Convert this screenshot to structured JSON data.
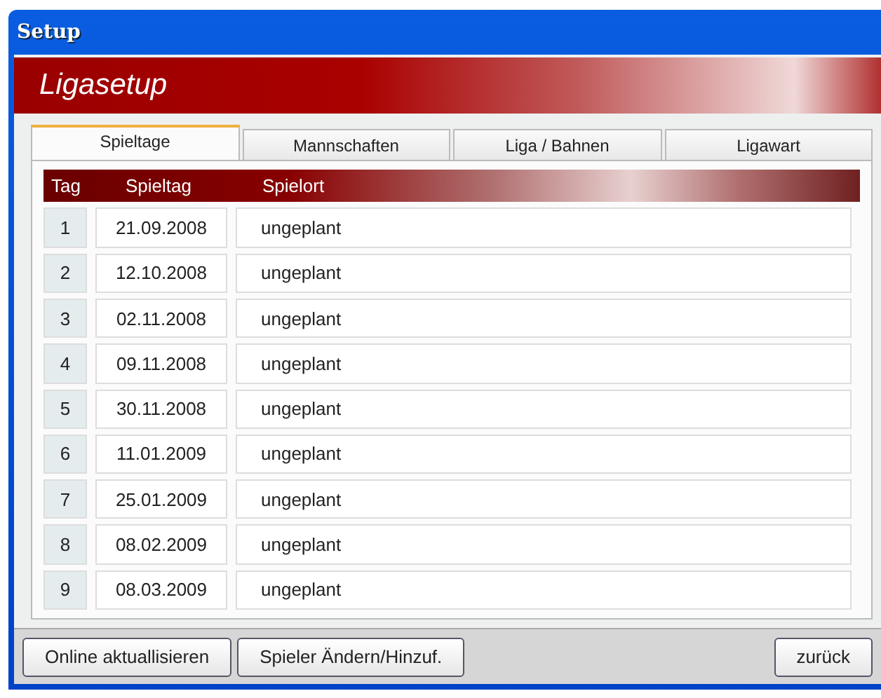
{
  "window": {
    "title": "Setup"
  },
  "header": {
    "title": "Ligasetup"
  },
  "tabs": [
    {
      "label": "Spieltage",
      "selected": true
    },
    {
      "label": "Mannschaften",
      "selected": false
    },
    {
      "label": "Liga / Bahnen",
      "selected": false
    },
    {
      "label": "Ligawart",
      "selected": false
    }
  ],
  "table": {
    "columns": [
      "Tag",
      "Spieltag",
      "Spielort"
    ],
    "rows": [
      [
        "1",
        "21.09.2008",
        "ungeplant"
      ],
      [
        "2",
        "12.10.2008",
        "ungeplant"
      ],
      [
        "3",
        "02.11.2008",
        "ungeplant"
      ],
      [
        "4",
        "09.11.2008",
        "ungeplant"
      ],
      [
        "5",
        "30.11.2008",
        "ungeplant"
      ],
      [
        "6",
        "11.01.2009",
        "ungeplant"
      ],
      [
        "7",
        "25.01.2009",
        "ungeplant"
      ],
      [
        "8",
        "08.02.2009",
        "ungeplant"
      ],
      [
        "9",
        "08.03.2009",
        "ungeplant"
      ]
    ]
  },
  "buttons": {
    "left": [
      "Online aktuallisieren",
      "Spieler Ändern/Hinzuf."
    ],
    "right": [
      "zurück"
    ]
  }
}
